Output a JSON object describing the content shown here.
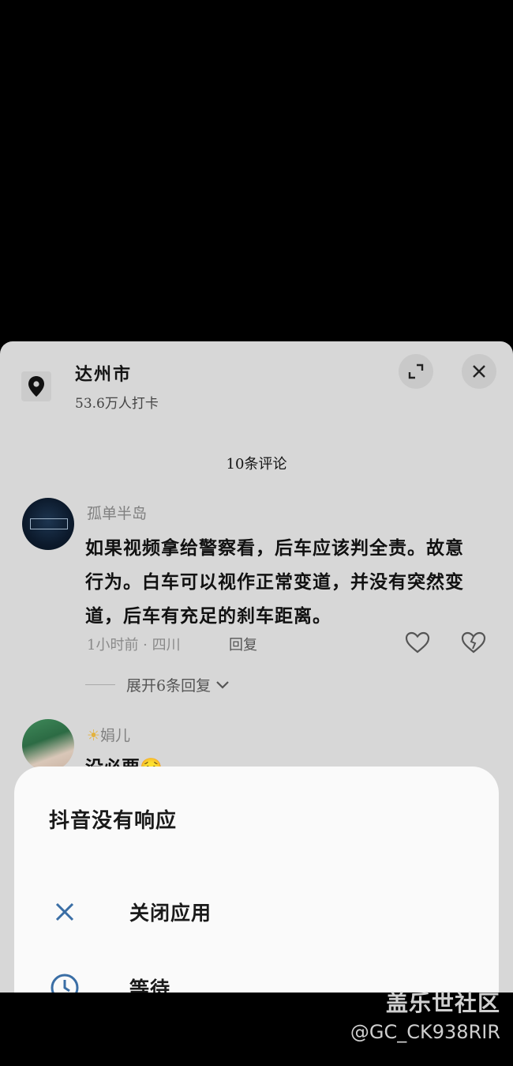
{
  "location": {
    "title": "达州市",
    "subtitle": "53.6万人打卡",
    "icon": "location-pin-icon"
  },
  "header_buttons": {
    "expand_icon": "expand-icon",
    "close_icon": "close-icon"
  },
  "comments": {
    "count_label": "10条评论",
    "items": [
      {
        "username": "孤单半岛",
        "text": "如果视频拿给警察看，后车应该判全责。故意行为。白车可以视作正常变道，并没有突然变道，后车有充足的刹车距离。",
        "meta": "1小时前 · 四川",
        "reply_label": "回复",
        "expand_replies": "展开6条回复"
      },
      {
        "username": "娟儿",
        "text": "没必要"
      }
    ]
  },
  "dialog": {
    "title": "抖音没有响应",
    "options": [
      {
        "label": "关闭应用",
        "icon": "close-x-icon"
      },
      {
        "label": "等待",
        "icon": "clock-icon"
      }
    ]
  },
  "watermark": {
    "line1": "盖乐世社区",
    "line2": "@GC_CK938RIR"
  },
  "colors": {
    "sheet_bg": "#d7d7d7",
    "dialog_bg": "#fafafa",
    "accent_blue": "#3a6ea5"
  }
}
